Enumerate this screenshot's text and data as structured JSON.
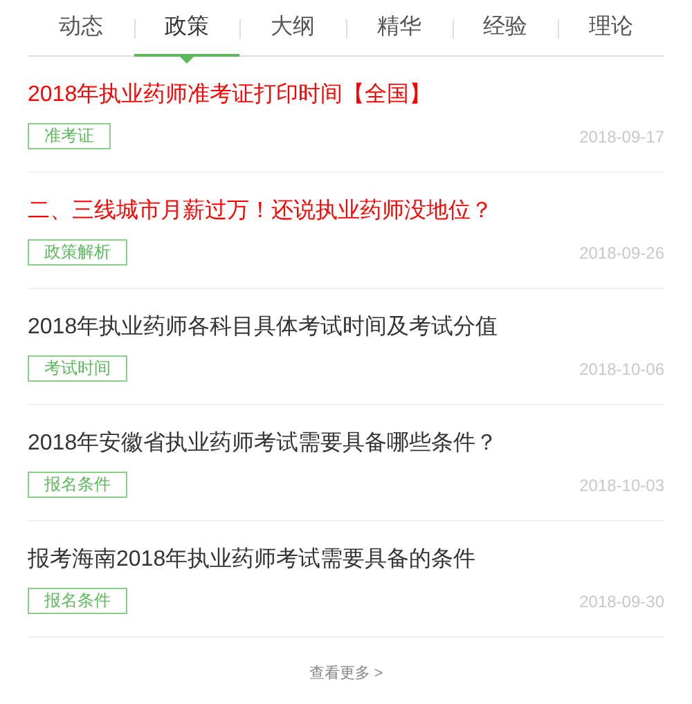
{
  "tabs": [
    {
      "label": "动态",
      "selected": false
    },
    {
      "label": "政策",
      "selected": true
    },
    {
      "label": "大纲",
      "selected": false
    },
    {
      "label": "精华",
      "selected": false
    },
    {
      "label": "经验",
      "selected": false
    },
    {
      "label": "理论",
      "selected": false
    }
  ],
  "articles": [
    {
      "title": "2018年执业药师准考证打印时间【全国】",
      "highlighted": true,
      "tag": "准考证",
      "date": "2018-09-17"
    },
    {
      "title": "二、三线城市月薪过万！还说执业药师没地位？",
      "highlighted": true,
      "tag": "政策解析",
      "date": "2018-09-26"
    },
    {
      "title": "2018年执业药师各科目具体考试时间及考试分值",
      "highlighted": false,
      "tag": "考试时间",
      "date": "2018-10-06"
    },
    {
      "title": "2018年安徽省执业药师考试需要具备哪些条件？",
      "highlighted": false,
      "tag": "报名条件",
      "date": "2018-10-03"
    },
    {
      "title": "报考海南2018年执业药师考试需要具备的条件",
      "highlighted": false,
      "tag": "报名条件",
      "date": "2018-09-30"
    }
  ],
  "more_link": "查看更多 >"
}
